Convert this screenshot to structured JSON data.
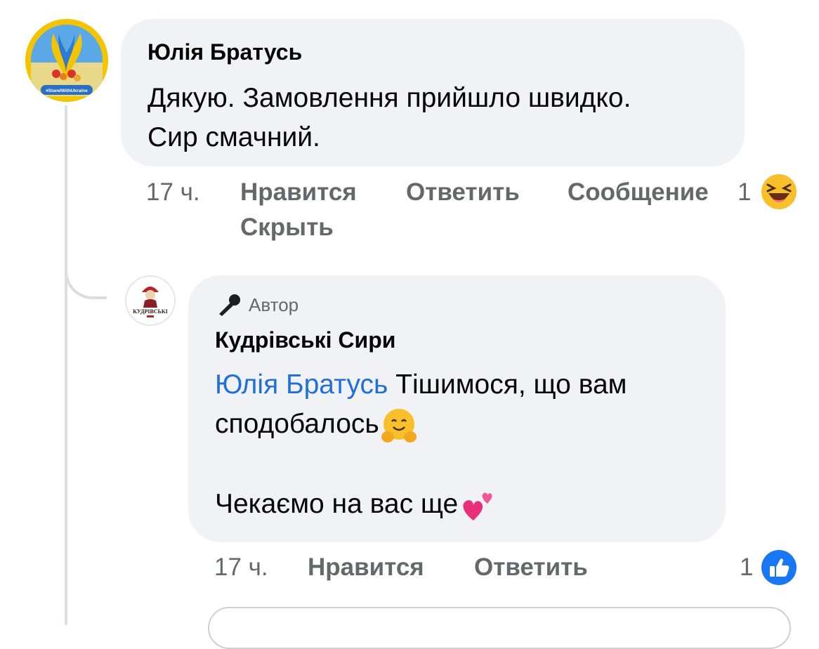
{
  "comment": {
    "author": "Юлія Братусь",
    "text_line1": "Дякую. Замовлення прийшло швидко.",
    "text_line2": "Сир смачний.",
    "time": "17 ч.",
    "like_label": "Нравится",
    "reply_label": "Ответить",
    "message_label": "Сообщение",
    "reaction_count": "1",
    "reaction_icon": "laughing-emoji",
    "hide_label": "Скрыть",
    "avatar_badge_text": "#StandWithUkraine"
  },
  "reply": {
    "badge_icon": "microphone-icon",
    "badge_label": "Автор",
    "author": "Кудрівські Сири",
    "mention": "Юлія Братусь",
    "text_part1": " Тішимося, що вам",
    "text_part2": "сподобалось",
    "text_part3": "Чекаємо на вас ще",
    "time": "17 ч.",
    "like_label": "Нравится",
    "reply_label": "Ответить",
    "reaction_count": "1",
    "reaction_icon": "thumbs-up-icon",
    "avatar_logo_text": "КУДРІВСЬКІ"
  },
  "colors": {
    "bubble": "#f0f2f5",
    "link": "#216fdb",
    "meta": "#65676b",
    "like_blue": "#1877f2"
  }
}
